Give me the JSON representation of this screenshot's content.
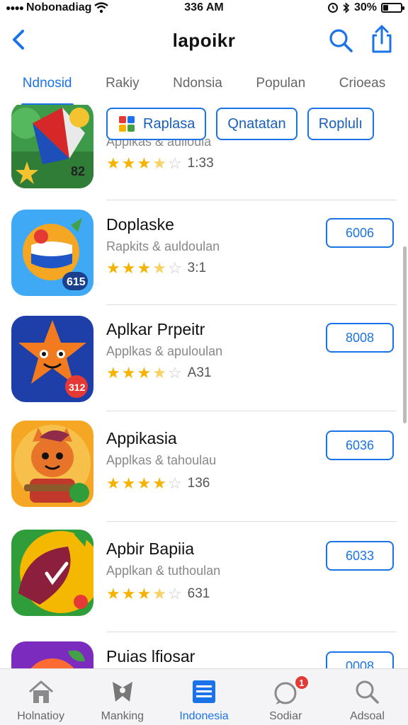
{
  "status_bar": {
    "carrier": "Nobonadiag",
    "time": "336 AM",
    "battery": "30%",
    "battery_level": 0.3
  },
  "header": {
    "title": "lapoikr"
  },
  "tabs": [
    {
      "label": "Ndnosid",
      "active": true
    },
    {
      "label": "Rakiy",
      "active": false
    },
    {
      "label": "Ndonsia",
      "active": false
    },
    {
      "label": "Populan",
      "active": false
    },
    {
      "label": "Crioeas",
      "active": false
    }
  ],
  "chips": [
    {
      "label": "Raplasa"
    },
    {
      "label": "Qnatatan"
    },
    {
      "label": "Roplulı"
    }
  ],
  "apps": [
    {
      "name": "",
      "subtitle": "Applkas & aulioula",
      "rating": 3.5,
      "rating_text": "1:33",
      "button": "",
      "icon": "kite-icon",
      "icon_colors": [
        "#2f8a3a",
        "#f4c430"
      ]
    },
    {
      "name": "Doplaske",
      "subtitle": "Rapkits & auldoulan",
      "rating": 3.5,
      "rating_text": "3:1",
      "button": "6006",
      "icon": "globe-icon",
      "icon_colors": [
        "#3fa9f5",
        "#f5a623"
      ]
    },
    {
      "name": "Aplkar Prpeitr",
      "subtitle": "Applkas & apuloulan",
      "rating": 3.5,
      "rating_text": "A31",
      "button": "8008",
      "icon": "fox-face-icon",
      "icon_colors": [
        "#1f3fa8",
        "#f27b1f"
      ]
    },
    {
      "name": "Appikasia",
      "subtitle": "Applkas & tahoulau",
      "rating": 4,
      "rating_text": "136",
      "button": "6036",
      "icon": "fox-character-icon",
      "icon_colors": [
        "#f5a623",
        "#c0392b"
      ]
    },
    {
      "name": "Apbir Bapiia",
      "subtitle": "Applkan & tuthoulan",
      "rating": 3.5,
      "rating_text": "631",
      "button": "6033",
      "icon": "leaf-icon",
      "icon_colors": [
        "#2e9d3a",
        "#f5b800"
      ]
    },
    {
      "name": "Puias lfiosar",
      "subtitle": "",
      "rating": 0,
      "rating_text": "",
      "button": "0008",
      "icon": "fruit-icon",
      "icon_colors": [
        "#7b2bbd",
        "#ff6b35"
      ]
    }
  ],
  "tabbar": [
    {
      "label": "Holnatioy",
      "icon": "home-icon",
      "active": false
    },
    {
      "label": "Manking",
      "icon": "ranking-icon",
      "active": false
    },
    {
      "label": "Indonesia",
      "icon": "list-icon",
      "active": true
    },
    {
      "label": "Sodiar",
      "icon": "social-icon",
      "active": false,
      "badge": "1"
    },
    {
      "label": "Adsoal",
      "icon": "search-icon",
      "active": false
    }
  ],
  "colors": {
    "accent": "#1a73e8",
    "star": "#f5b300",
    "badge": "#e53935"
  }
}
